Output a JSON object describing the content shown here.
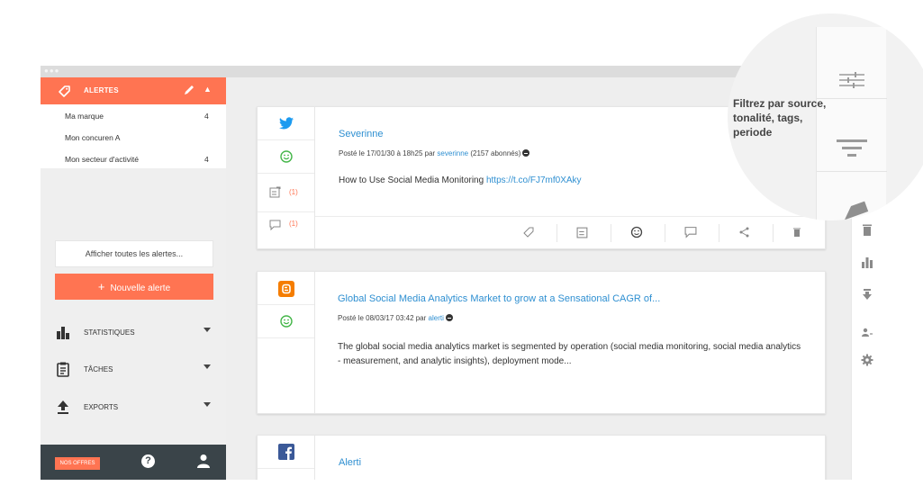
{
  "sidebar": {
    "alerts_header": "ALERTES",
    "alerts": [
      {
        "label": "Ma marque",
        "count": "4"
      },
      {
        "label": "Mon concuren A",
        "count": ""
      },
      {
        "label": "Mon secteur d'activité",
        "count": "4"
      }
    ],
    "show_all": "Afficher toutes les alertes...",
    "new_alert": "Nouvelle alerte",
    "sections": [
      {
        "label": "STATISTIQUES",
        "icon": "bar-chart-icon"
      },
      {
        "label": "TÂCHES",
        "icon": "clipboard-icon"
      },
      {
        "label": "EXPORTS",
        "icon": "upload-icon"
      }
    ],
    "offers": "NOS OFFRES",
    "help": "?"
  },
  "posts": [
    {
      "source": "twitter",
      "title": "Severinne",
      "meta_prefix": "Posté le 17/01/30 à 18h25 par ",
      "author": "severinne",
      "meta_suffix": " (2157 abonnés)",
      "text": "How to Use Social Media Monitoring ",
      "link": "https://t.co/FJ7mf0XAky",
      "task_count": "(1)",
      "comment_count": "(1)"
    },
    {
      "source": "blogger",
      "title": "Global Social Media Analytics Market to grow at a Sensational CAGR of...",
      "meta_prefix": "Posté le 08/03/17 03:42 par ",
      "author": "alerti",
      "text": "The global social media analytics market is segmented by operation (social media monitoring, social media analytics - measurement, and analytic insights), deployment mode..."
    },
    {
      "source": "facebook",
      "title": "Alerti"
    }
  ],
  "magnifier": {
    "text": "Filtrez par source, tonalité, tags, periode"
  },
  "colors": {
    "accent": "#ff7452",
    "link": "#2e8fd1",
    "dark": "#3a4449",
    "twitter": "#1d9bf0",
    "positive": "#44b649",
    "blogger": "#f57d00",
    "facebook": "#3b5998"
  }
}
